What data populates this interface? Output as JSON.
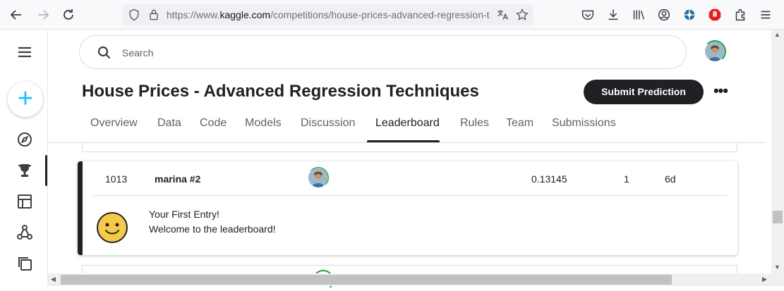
{
  "browser": {
    "url_prefix": "https://www.",
    "url_host": "kaggle.com",
    "url_path": "/competitions/house-prices-advanced-regression-t",
    "icons": [
      "back-icon",
      "forward-icon",
      "reload-icon",
      "shield-icon",
      "lock-icon",
      "translate-icon",
      "bookmark-star-icon",
      "pocket-icon",
      "download-icon",
      "library-icon",
      "account-icon",
      "extension-icon",
      "adblock-icon",
      "extensions-puzzle-icon",
      "menu-icon"
    ]
  },
  "sidebar": {
    "items": [
      "menu-icon",
      "create-icon",
      "explore-icon",
      "competitions-icon",
      "datasets-icon",
      "models-icon",
      "code-icon"
    ],
    "create_label": "+"
  },
  "search": {
    "placeholder": "Search"
  },
  "competition": {
    "title": "House Prices - Advanced Regression Techniques",
    "submit_label": "Submit Prediction",
    "more_label": "•••"
  },
  "tabs": [
    {
      "label": "Overview"
    },
    {
      "label": "Data"
    },
    {
      "label": "Code"
    },
    {
      "label": "Models"
    },
    {
      "label": "Discussion"
    },
    {
      "label": "Leaderboard",
      "active": true
    },
    {
      "label": "Rules"
    },
    {
      "label": "Team"
    },
    {
      "label": "Submissions"
    }
  ],
  "entry": {
    "rank": "1013",
    "team": "marina #2",
    "score": "0.13145",
    "entries": "1",
    "last": "6d",
    "message_title": "Your First Entry!",
    "message_body": "Welcome to the leaderboard!"
  },
  "colors": {
    "accent": "#20beff",
    "dark": "#202124",
    "ring": "#20a33f",
    "smiley": "#f7c948"
  }
}
